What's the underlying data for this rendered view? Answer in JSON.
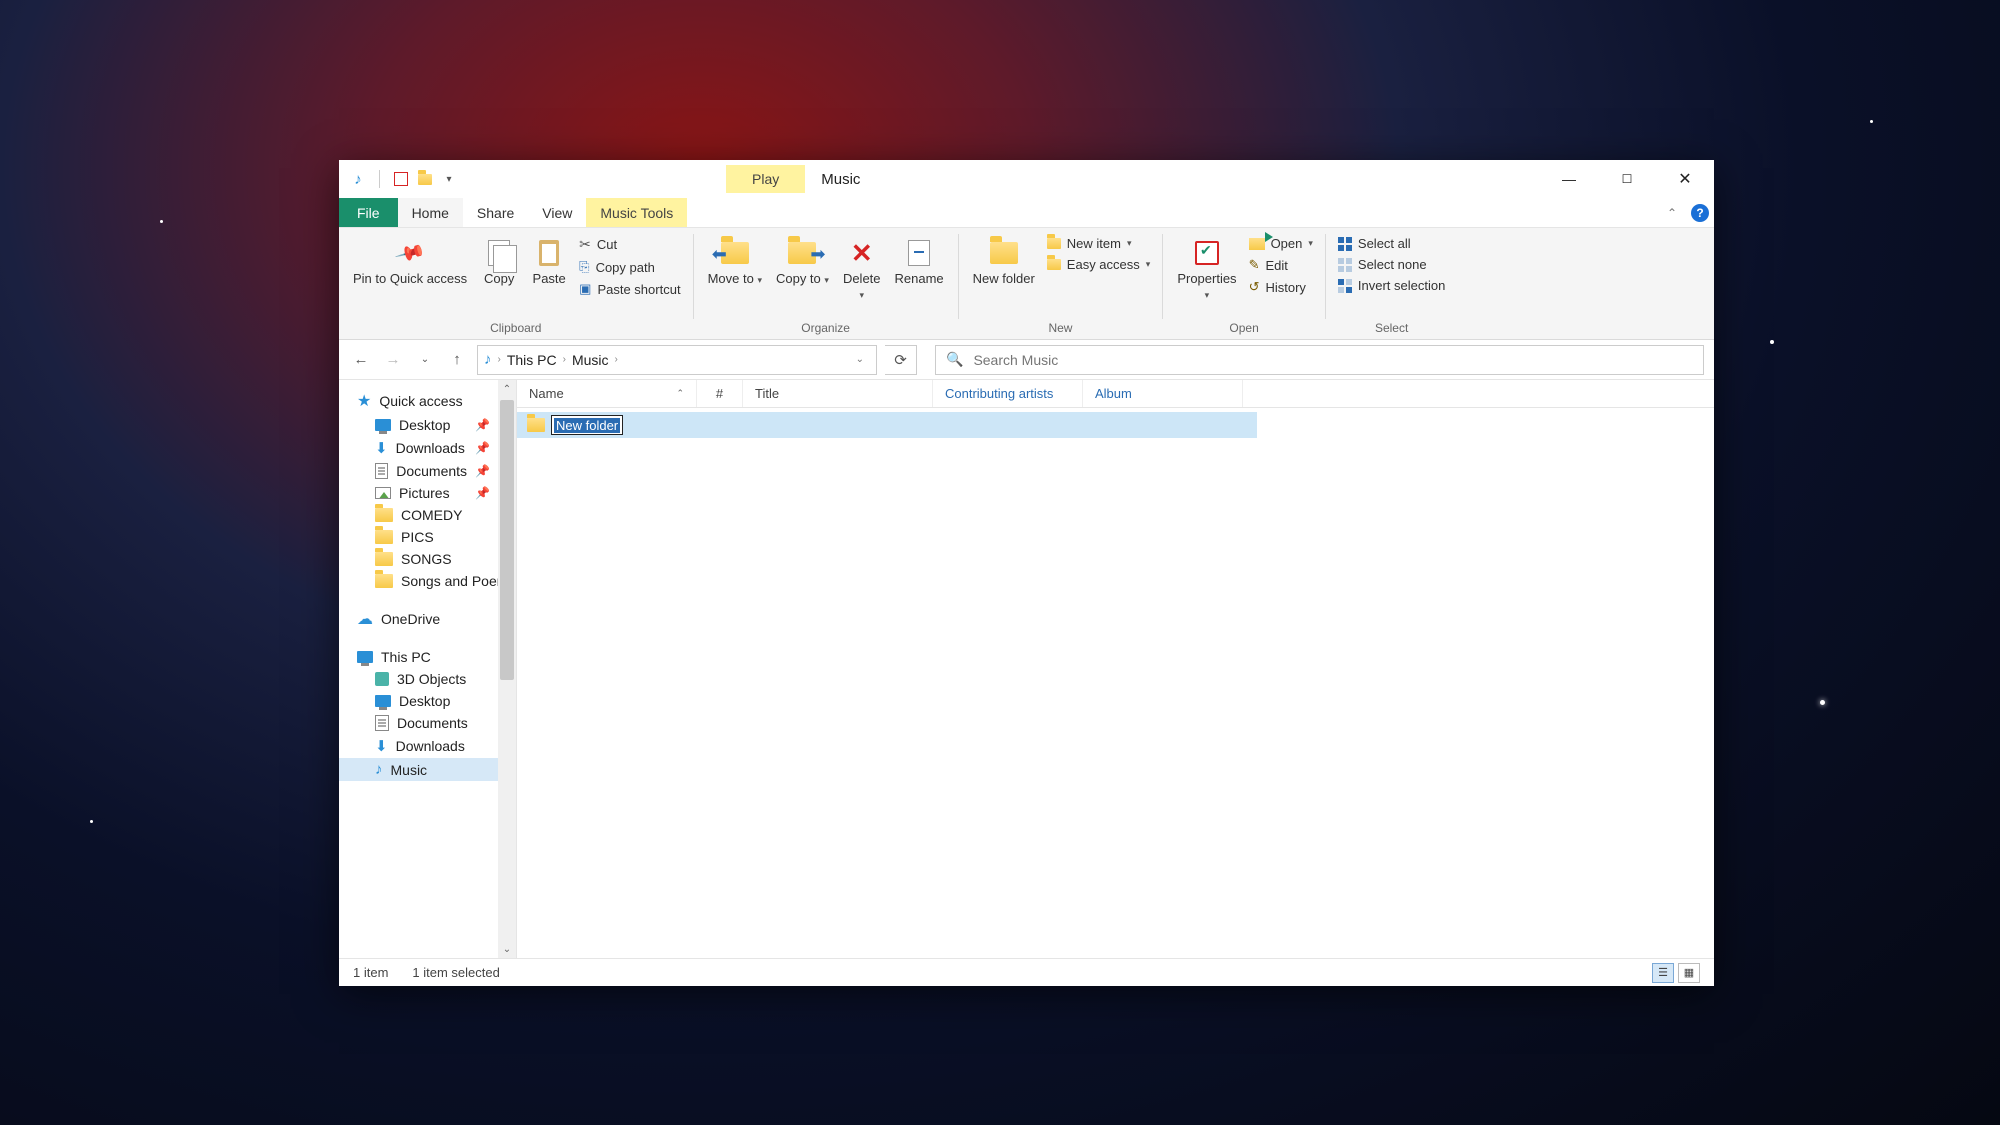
{
  "title": "Music",
  "titlebar": {
    "play_tab": "Play"
  },
  "tabs": {
    "file": "File",
    "home": "Home",
    "share": "Share",
    "view": "View",
    "music_tools": "Music Tools"
  },
  "ribbon": {
    "clipboard": {
      "label": "Clipboard",
      "pin": "Pin to Quick access",
      "copy": "Copy",
      "paste": "Paste",
      "cut": "Cut",
      "copy_path": "Copy path",
      "paste_shortcut": "Paste shortcut"
    },
    "organize": {
      "label": "Organize",
      "move_to": "Move to",
      "copy_to": "Copy to",
      "delete": "Delete",
      "rename": "Rename"
    },
    "new": {
      "label": "New",
      "new_folder": "New folder",
      "new_item": "New item",
      "easy_access": "Easy access"
    },
    "open": {
      "label": "Open",
      "properties": "Properties",
      "open": "Open",
      "edit": "Edit",
      "history": "History"
    },
    "select": {
      "label": "Select",
      "select_all": "Select all",
      "select_none": "Select none",
      "invert": "Invert selection"
    }
  },
  "breadcrumb": {
    "this_pc": "This PC",
    "music": "Music"
  },
  "search": {
    "placeholder": "Search Music"
  },
  "nav": {
    "quick_access": "Quick access",
    "desktop": "Desktop",
    "downloads": "Downloads",
    "documents": "Documents",
    "pictures": "Pictures",
    "comedy": "COMEDY",
    "pics": "PICS",
    "songs": "SONGS",
    "songs_poems": "Songs and Poem",
    "onedrive": "OneDrive",
    "this_pc": "This PC",
    "objects3d": "3D Objects",
    "desktop2": "Desktop",
    "documents2": "Documents",
    "downloads2": "Downloads",
    "music": "Music"
  },
  "columns": {
    "name": "Name",
    "num": "#",
    "title": "Title",
    "artists": "Contributing artists",
    "album": "Album"
  },
  "files": {
    "new_folder": "New folder"
  },
  "status": {
    "count": "1 item",
    "selected": "1 item selected"
  }
}
